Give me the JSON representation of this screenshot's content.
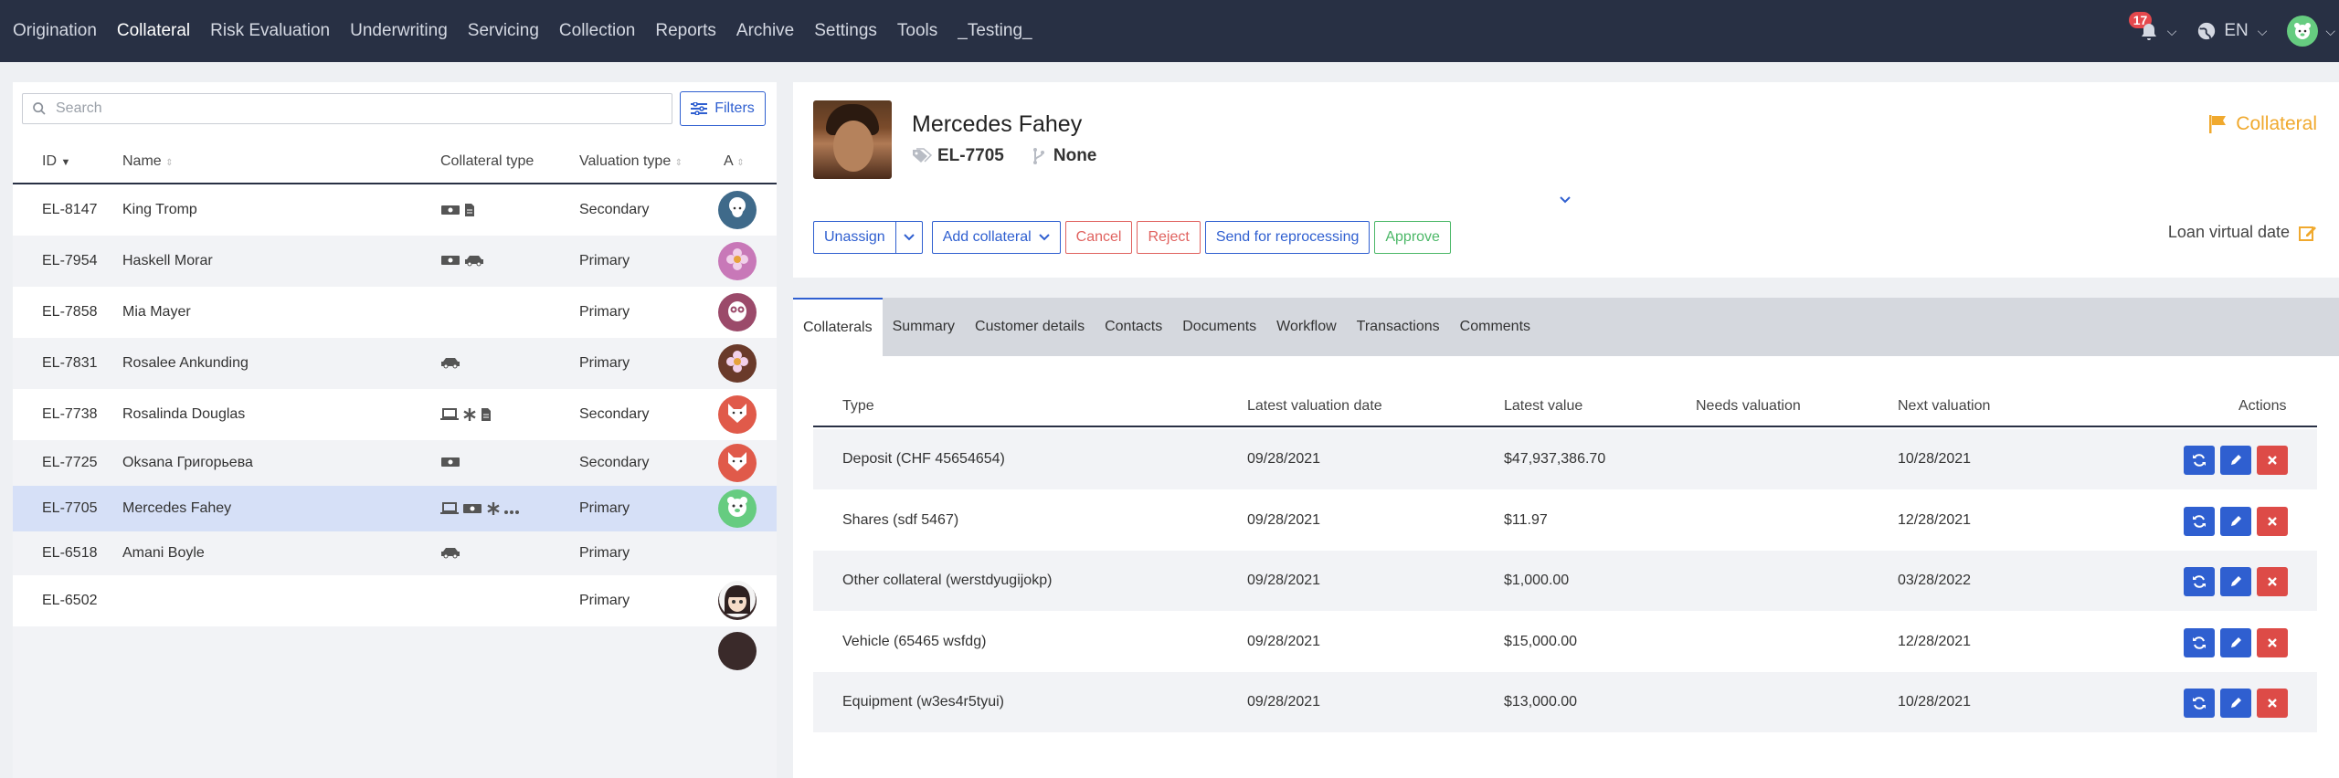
{
  "nav": {
    "items": [
      "Origination",
      "Collateral",
      "Risk Evaluation",
      "Underwriting",
      "Servicing",
      "Collection",
      "Reports",
      "Archive",
      "Settings",
      "Tools",
      "_Testing_"
    ],
    "active": "Collateral",
    "notifications_count": "17",
    "language": "EN"
  },
  "list": {
    "search_placeholder": "Search",
    "filters_label": "Filters",
    "headers": {
      "id": "ID",
      "name": "Name",
      "collateral_type": "Collateral type",
      "valuation_type": "Valuation type",
      "avatar": "A"
    },
    "rows": [
      {
        "id": "EL-8147",
        "name": "King Tromp",
        "icons": [
          "money-icon",
          "document-icon"
        ],
        "valuation": "Secondary",
        "avatar_color": "#3f6a8a",
        "avatar_icon": "sheep-icon"
      },
      {
        "id": "EL-7954",
        "name": "Haskell Morar",
        "icons": [
          "money-icon",
          "car-icon"
        ],
        "valuation": "Primary",
        "avatar_color": "#c878b8",
        "avatar_icon": "flower-icon"
      },
      {
        "id": "EL-7858",
        "name": "Mia Mayer",
        "icons": [],
        "valuation": "Primary",
        "avatar_color": "#9b4a6a",
        "avatar_icon": "owl-icon"
      },
      {
        "id": "EL-7831",
        "name": "Rosalee Ankunding",
        "icons": [
          "car-icon"
        ],
        "valuation": "Primary",
        "avatar_color": "#6a3a2a",
        "avatar_icon": "flower-icon"
      },
      {
        "id": "EL-7738",
        "name": "Rosalinda Douglas",
        "icons": [
          "laptop-icon",
          "asterisk-icon",
          "document-icon"
        ],
        "valuation": "Secondary",
        "avatar_color": "#e05a4a",
        "avatar_icon": "fox-icon"
      },
      {
        "id": "EL-7725",
        "name": "Oksana Григорьева",
        "icons": [
          "money-icon"
        ],
        "valuation": "Secondary",
        "avatar_color": "#e05a4a",
        "avatar_icon": "fox-icon"
      },
      {
        "id": "EL-7705",
        "name": "Mercedes Fahey",
        "icons": [
          "laptop-icon",
          "money-icon",
          "asterisk-icon",
          "more-icon"
        ],
        "valuation": "Primary",
        "avatar_color": "#66cc80",
        "avatar_icon": "bear-icon",
        "selected": true
      },
      {
        "id": "EL-6518",
        "name": "Amani Boyle",
        "icons": [
          "car-icon"
        ],
        "valuation": "Primary",
        "avatar_color": "",
        "avatar_icon": ""
      },
      {
        "id": "EL-6502",
        "name": "",
        "icons": [],
        "valuation": "Primary",
        "avatar_color": "#3a2a2a",
        "avatar_icon": "girl-icon"
      }
    ]
  },
  "detail": {
    "name": "Mercedes Fahey",
    "loan_id": "EL-7705",
    "branch": "None",
    "section": "Collateral",
    "buttons": {
      "unassign": "Unassign",
      "add_collateral": "Add collateral",
      "cancel": "Cancel",
      "reject": "Reject",
      "reprocess": "Send for reprocessing",
      "approve": "Approve"
    },
    "loan_virtual_date": "Loan virtual date"
  },
  "tabs": [
    "Collaterals",
    "Summary",
    "Customer details",
    "Contacts",
    "Documents",
    "Workflow",
    "Transactions",
    "Comments"
  ],
  "collaterals": {
    "headers": {
      "type": "Type",
      "latest_date": "Latest valuation date",
      "latest_value": "Latest value",
      "needs": "Needs valuation",
      "next": "Next valuation",
      "actions": "Actions"
    },
    "rows": [
      {
        "type": "Deposit (CHF 45654654)",
        "date": "09/28/2021",
        "value": "$47,937,386.70",
        "needs": "",
        "next": "10/28/2021"
      },
      {
        "type": "Shares (sdf 5467)",
        "date": "09/28/2021",
        "value": "$11.97",
        "needs": "",
        "next": "12/28/2021"
      },
      {
        "type": "Other collateral (werstdyugijokp)",
        "date": "09/28/2021",
        "value": "$1,000.00",
        "needs": "",
        "next": "03/28/2022"
      },
      {
        "type": "Vehicle (65465 wsfdg)",
        "date": "09/28/2021",
        "value": "$15,000.00",
        "needs": "",
        "next": "12/28/2021"
      },
      {
        "type": "Equipment (w3es4r5tyui)",
        "date": "09/28/2021",
        "value": "$13,000.00",
        "needs": "",
        "next": "10/28/2021"
      }
    ]
  }
}
